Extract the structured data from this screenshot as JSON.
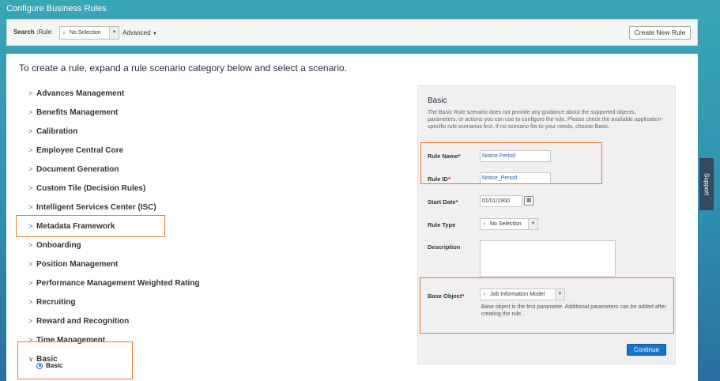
{
  "window": {
    "title": "Configure Business Rules"
  },
  "toolbar": {
    "search_label": "Search :",
    "search_field_label": "Rule",
    "search_value": "No Selection",
    "advanced_label": "Advanced",
    "create_button": "Create New Rule"
  },
  "main": {
    "intro": "To create a rule, expand a rule scenario category below and select a scenario.",
    "categories": [
      "Advances Management",
      "Benefits Management",
      "Calibration",
      "Employee Central Core",
      "Document Generation",
      "Custom Tile (Decision Rules)",
      "Intelligent Services Center (ISC)",
      "Metadata Framework",
      "Onboarding",
      "Position Management",
      "Performance Management Weighted Rating",
      "Recruiting",
      "Reward and Recognition",
      "Time Management",
      "Basic"
    ],
    "expanded_scenario": "Basic"
  },
  "panel": {
    "title": "Basic",
    "description": "The Basic Rule scenario does not provide any guidance about the supported objects, parameters, or actions you can use to configure the rule. Please check the available application-specific rule scenarios first. If no scenario fits to your needs, choose Basic.",
    "rule_name_label": "Rule Name",
    "rule_name_value": "Notice Period",
    "rule_id_label": "Rule ID",
    "rule_id_value": "Notice_Period",
    "start_date_label": "Start Date",
    "start_date_value": "01/01/1900",
    "rule_type_label": "Rule Type",
    "rule_type_value": "No Selection",
    "description_label": "Description",
    "base_object_label": "Base Object",
    "base_object_value": "Job Information Model",
    "base_object_help": "Base object is the first parameter. Additional parameters can be added after creating the rule.",
    "continue_button": "Continue",
    "required_marker": "*"
  },
  "support_tab": "Support",
  "colors": {
    "accent": "#1874c7",
    "highlight": "#e87a30",
    "header": "#3aa6b5"
  }
}
